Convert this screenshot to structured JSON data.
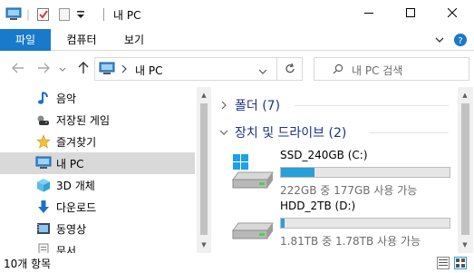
{
  "window": {
    "title": "내 PC",
    "controls": {
      "minimize": "minimize-icon",
      "maximize": "maximize-icon",
      "close": "close-icon"
    }
  },
  "ribbon": {
    "tabs": [
      "파일",
      "컴퓨터",
      "보기"
    ],
    "active_tab_color": "#1979ca"
  },
  "address": {
    "path_label": "내 PC",
    "search_placeholder": "내 PC 검색"
  },
  "nav": {
    "items": [
      {
        "label": "음악",
        "icon": "music-icon"
      },
      {
        "label": "저장된 게임",
        "icon": "saved-games-icon"
      },
      {
        "label": "즐겨찾기",
        "icon": "favorites-icon"
      },
      {
        "label": "내 PC",
        "icon": "computer-icon",
        "selected": true
      },
      {
        "label": "3D 개체",
        "icon": "3d-objects-icon"
      },
      {
        "label": "다운로드",
        "icon": "download-icon"
      },
      {
        "label": "동영상",
        "icon": "videos-icon"
      },
      {
        "label": "문서",
        "icon": "documents-icon"
      }
    ]
  },
  "content": {
    "groups": [
      {
        "label": "폴더 (7)",
        "expanded": false
      },
      {
        "label": "장치 및 드라이브 (2)",
        "expanded": true
      }
    ],
    "drives": [
      {
        "name": "SSD_240GB (C:)",
        "info": "222GB 중 177GB 사용 가능",
        "used_fraction": 0.2,
        "has_windows_logo": true
      },
      {
        "name": "HDD_2TB (D:)",
        "info": "1.81TB 중 1.78TB 사용 가능",
        "used_fraction": 0.02,
        "has_windows_logo": false
      }
    ],
    "bar_color": "#26a0da"
  },
  "status": {
    "item_count": "10개 항목"
  }
}
